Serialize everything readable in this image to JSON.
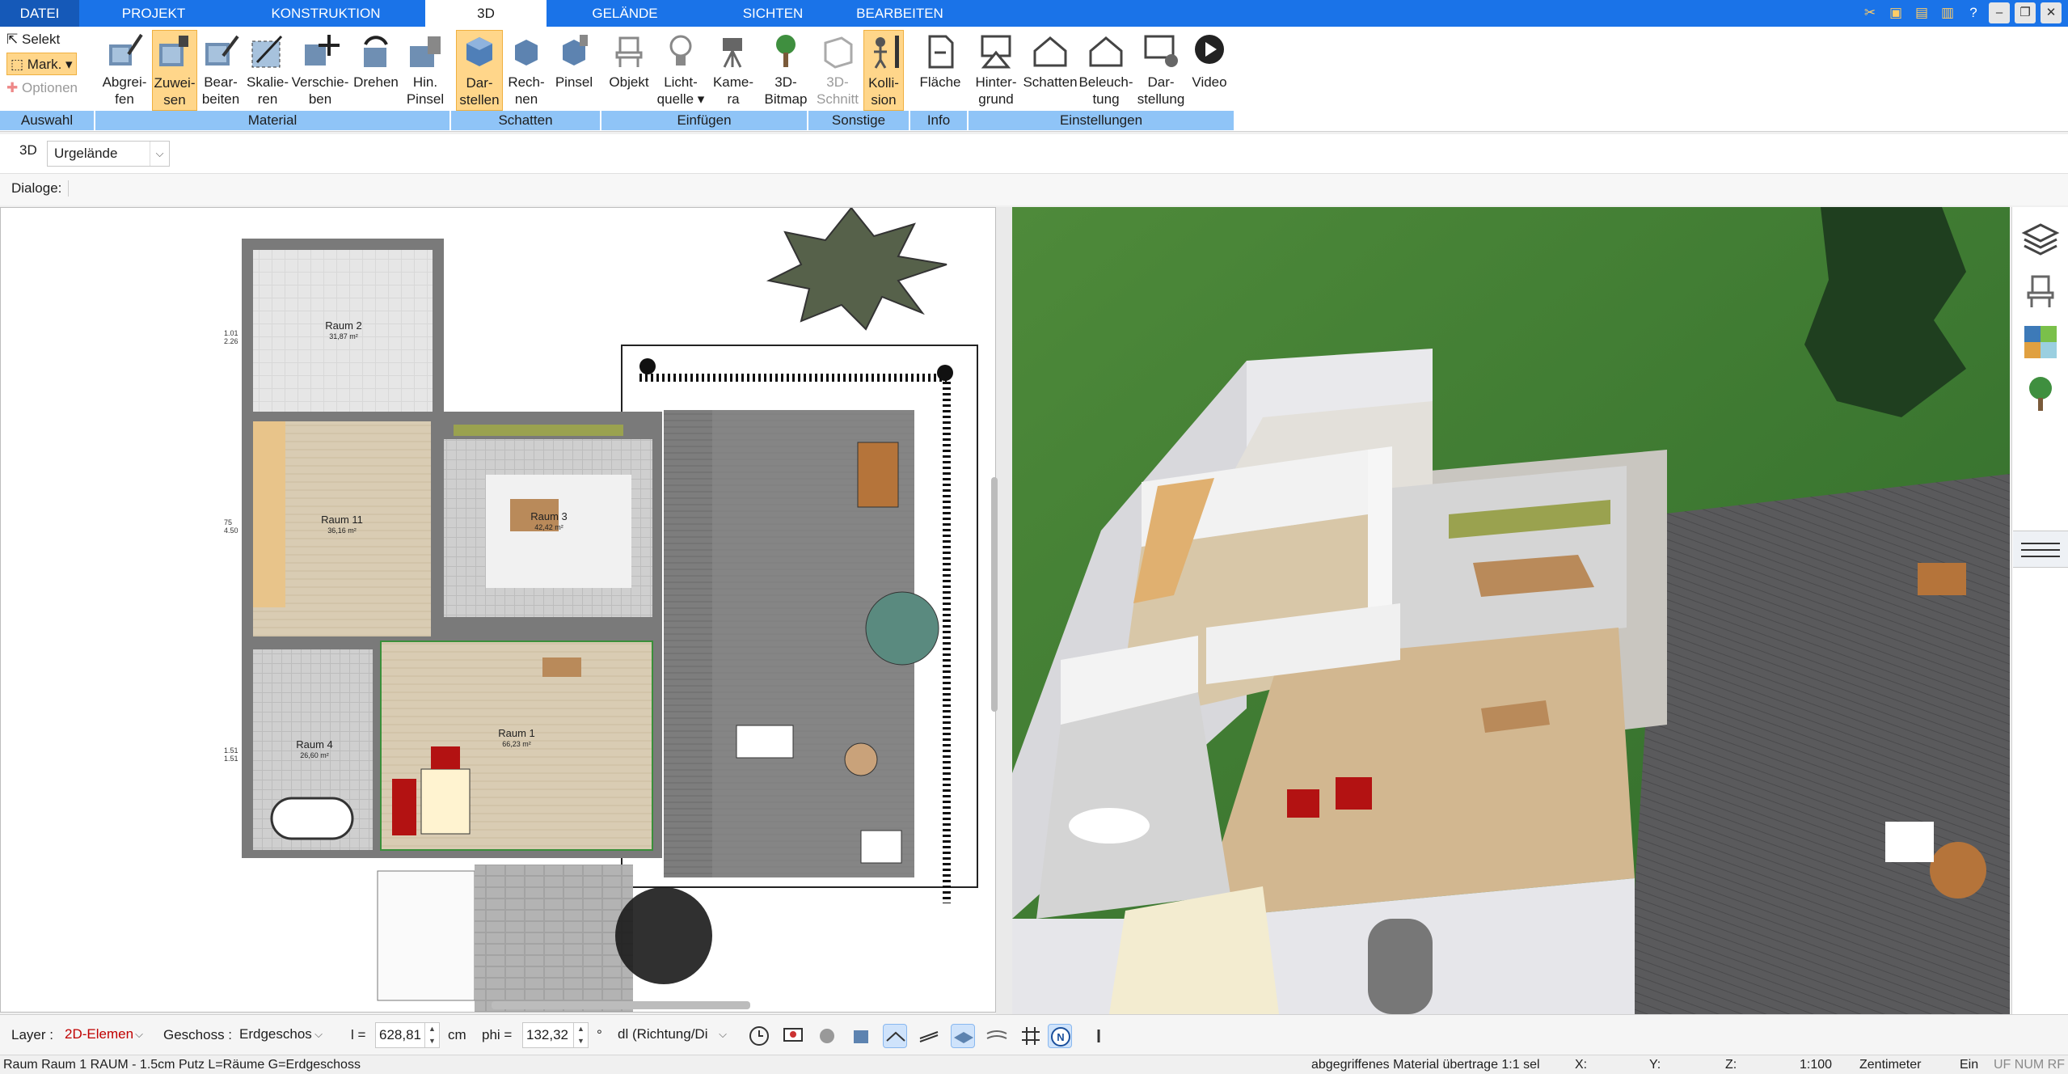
{
  "menu_tabs": [
    {
      "label": "DATEI"
    },
    {
      "label": "PROJEKT"
    },
    {
      "label": "KONSTRUKTION"
    },
    {
      "label": "3D"
    },
    {
      "label": "GELÄNDE"
    },
    {
      "label": "SICHTEN"
    },
    {
      "label": "BEARBEITEN"
    }
  ],
  "ribbon": {
    "auswahl": {
      "selekt": "Selekt",
      "mark": "Mark.",
      "optionen": "Optionen",
      "group": "Auswahl"
    },
    "buttons": [
      {
        "line1": "Abgrei-",
        "line2": "fen",
        "icon": "eyedropper-icon"
      },
      {
        "line1": "Zuwei-",
        "line2": "sen",
        "icon": "assign-material-icon"
      },
      {
        "line1": "Bear-",
        "line2": "beiten",
        "icon": "edit-material-icon"
      },
      {
        "line1": "Skalie-",
        "line2": "ren",
        "icon": "scale-icon"
      },
      {
        "line1": "Verschie-",
        "line2": "ben",
        "icon": "move-icon"
      },
      {
        "line1": "Drehen",
        "line2": "",
        "icon": "rotate-icon"
      },
      {
        "line1": "Hin.",
        "line2": "Pinsel",
        "icon": "brush-icon"
      },
      {
        "line1": "Dar-",
        "line2": "stellen",
        "icon": "shadow-display-icon"
      },
      {
        "line1": "Rech-",
        "line2": "nen",
        "icon": "shadow-calc-icon"
      },
      {
        "line1": "Pinsel",
        "line2": "",
        "icon": "shadow-brush-icon"
      },
      {
        "line1": "Objekt",
        "line2": "",
        "icon": "object-chair-icon"
      },
      {
        "line1": "Licht-",
        "line2": "quelle",
        "icon": "lightbulb-icon"
      },
      {
        "line1": "Kame-",
        "line2": "ra",
        "icon": "camera-icon"
      },
      {
        "line1": "3D-",
        "line2": "Bitmap",
        "icon": "tree-bitmap-icon"
      },
      {
        "line1": "3D-",
        "line2": "Schnitt",
        "icon": "section-icon"
      },
      {
        "line1": "Kolli-",
        "line2": "sion",
        "icon": "collision-icon"
      },
      {
        "line1": "Fläche",
        "line2": "",
        "icon": "area-icon"
      },
      {
        "line1": "Hinter-",
        "line2": "grund",
        "icon": "background-icon"
      },
      {
        "line1": "Schatten",
        "line2": "",
        "icon": "house-shadow-icon"
      },
      {
        "line1": "Beleuch-",
        "line2": "tung",
        "icon": "lighting-icon"
      },
      {
        "line1": "Dar-",
        "line2": "stellung",
        "icon": "display-settings-icon"
      },
      {
        "line1": "Video",
        "line2": "",
        "icon": "video-play-icon"
      }
    ],
    "groups": [
      "Material",
      "Schatten",
      "Einfügen",
      "Sonstige",
      "Info",
      "Einstellungen"
    ]
  },
  "row2": {
    "mode": "3D",
    "terrain_select": "Urgelände"
  },
  "row3": {
    "dialoge_label": "Dialoge:"
  },
  "plan": {
    "rooms": [
      {
        "name": "Raum 2",
        "area": "31,87 m²"
      },
      {
        "name": "Raum 11",
        "area": "36,16 m²"
      },
      {
        "name": "Raum 3",
        "area": "42,42 m²"
      },
      {
        "name": "Raum 1",
        "area": "66,23 m²"
      },
      {
        "name": "Raum 4",
        "area": "26,60 m²"
      }
    ],
    "dims": [
      "1.01",
      "2.26",
      "75",
      "4.50",
      "1.51",
      "1.51"
    ]
  },
  "layerbar": {
    "layer_label": "Layer :",
    "layer_value": "2D-Elemen",
    "geschoss_label": "Geschoss :",
    "geschoss_value": "Erdgeschos",
    "l_label": "l =",
    "l_value": "628,81",
    "l_unit": "cm",
    "phi_label": "phi =",
    "phi_value": "132,32",
    "phi_unit": "°",
    "dl_value": "dl (Richtung/Di"
  },
  "status": {
    "left": "Raum Raum 1 RAUM - 1.5cm Putz L=Räume G=Erdgeschoss",
    "message": "abgegriffenes Material übertrage 1:1 sel",
    "x": "X:",
    "y": "Y:",
    "z": "Z:",
    "scale": "1:100",
    "unit": "Zentimeter",
    "mode": "Ein",
    "flags": "UF NUM RF"
  },
  "colors": {
    "accent": "#1a73e8",
    "group_bar": "#8fc4f7",
    "selected": "#ffd68a",
    "grass": "#3d7a30"
  }
}
